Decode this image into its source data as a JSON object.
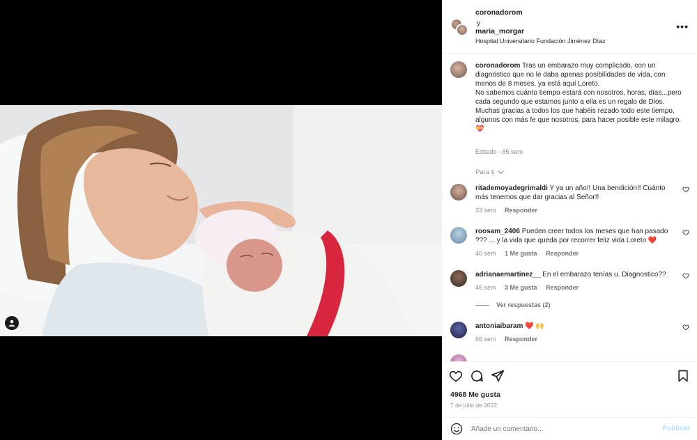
{
  "post": {
    "header": {
      "user1": "coronadorom",
      "conjunction": "y",
      "user2": "maria_morgar",
      "location": "Hospital Universitario Fundación Jiménez Díaz",
      "more_label": "•••"
    },
    "caption": {
      "user": "coronadorom",
      "text": "Tras un embarazo muy complicado, con un diagnóstico que no le daba apenas posibilidades de vida, con menos de 8 meses, ya está aquí Loreto.\nNo sabemos cuánto tiempo estará con nosotros, horas, días...pero cada segundo que estamos junto a ella es un regalo de Dios.\nMuchas gracias a todos los que habéis rezado todo este tiempo, algunos con más fe que nosotros, para hacer posible este milagro. 💝",
      "meta": "Editado · 85 sem"
    },
    "para_ti": "Para ti",
    "comments": [
      {
        "user": "ritademoyadegrimaldi",
        "text": "Y ya un año!! Una bendición!! Cuánto más tenemos que dar gracias al Señor!!",
        "time": "33 sem",
        "likes": "",
        "reply": "Responder",
        "avatar_color": "#b08f7e"
      },
      {
        "user": "roosam_2406",
        "text": "Pueden creer todos los meses que han pasado ??? ....y la vida que queda por recorrer feliz vida Loreto ❤️",
        "time": "40 sem",
        "likes": "1 Me gusta",
        "reply": "Responder",
        "avatar_color": "#7fa3c2"
      },
      {
        "user": "adrianaemartinez__",
        "text": "En el embarazo tenías u. Diagnostico??",
        "time": "46 sem",
        "likes": "3 Me gusta",
        "reply": "Responder",
        "avatar_color": "#5a3f33"
      },
      {
        "user": "antoniaibaram",
        "text": "❤️ 🙌",
        "time": "66 sem",
        "likes": "",
        "reply": "Responder",
        "avatar_color": "#2c2f5e"
      }
    ],
    "view_replies": "Ver respuestas (2)",
    "likes": "4968 Me gusta",
    "date": "7 de julio de 2022",
    "comment_placeholder": "Añade un comentario...",
    "publish_label": "Publicar"
  },
  "icons": {
    "like": "heart-icon",
    "comment": "comment-icon",
    "share": "paper-plane-icon",
    "save": "bookmark-icon",
    "emoji": "smiley-icon",
    "tag": "user-tag-icon"
  },
  "colors": {
    "link_disabled": "#b2dffc",
    "muted": "#8e8e8e",
    "heart_red": "#ed4956"
  }
}
